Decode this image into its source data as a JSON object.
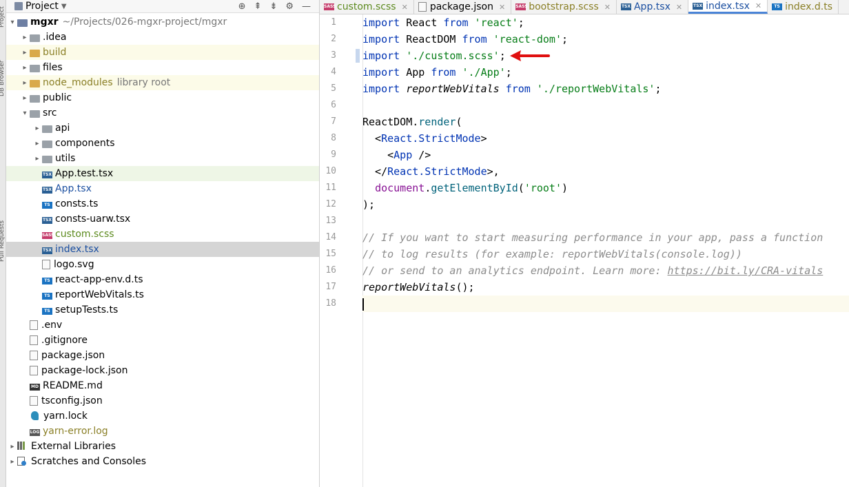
{
  "sidebar_strip": {
    "labels": [
      "Project",
      "DB Browser",
      "Pull Requests"
    ]
  },
  "panel": {
    "title": "Project",
    "tools": [
      "⊕",
      "⇞",
      "⇟",
      "⚙",
      "—"
    ]
  },
  "tree": [
    {
      "level": 0,
      "arrow": "▾",
      "icon": "module",
      "name": "mgxr",
      "extra": "~/Projects/026-mgxr-project/mgxr",
      "style": "bold"
    },
    {
      "level": 1,
      "arrow": "▸",
      "icon": "folder",
      "name": ".idea"
    },
    {
      "level": 1,
      "arrow": "▸",
      "icon": "folder-orange",
      "name": "build",
      "style": "olive",
      "bg": "hl"
    },
    {
      "level": 1,
      "arrow": "▸",
      "icon": "folder",
      "name": "files"
    },
    {
      "level": 1,
      "arrow": "▸",
      "icon": "folder-orange",
      "name": "node_modules",
      "extra": "library root",
      "style": "olive",
      "bg": "hl"
    },
    {
      "level": 1,
      "arrow": "▸",
      "icon": "folder",
      "name": "public"
    },
    {
      "level": 1,
      "arrow": "▾",
      "icon": "folder",
      "name": "src"
    },
    {
      "level": 2,
      "arrow": "▸",
      "icon": "folder",
      "name": "api"
    },
    {
      "level": 2,
      "arrow": "▸",
      "icon": "folder",
      "name": "components"
    },
    {
      "level": 2,
      "arrow": "▸",
      "icon": "folder",
      "name": "utils"
    },
    {
      "level": 2,
      "arrow": "",
      "icon": "TSX",
      "name": "App.test.tsx",
      "bg": "hl2"
    },
    {
      "level": 2,
      "arrow": "",
      "icon": "TSX",
      "name": "App.tsx",
      "style": "blue"
    },
    {
      "level": 2,
      "arrow": "",
      "icon": "TS",
      "name": "consts.ts"
    },
    {
      "level": 2,
      "arrow": "",
      "icon": "TSX",
      "name": "consts-uarw.tsx"
    },
    {
      "level": 2,
      "arrow": "",
      "icon": "SASS",
      "name": "custom.scss",
      "style": "green"
    },
    {
      "level": 2,
      "arrow": "",
      "icon": "TSX",
      "name": "index.tsx",
      "style": "blue",
      "bg": "sel"
    },
    {
      "level": 2,
      "arrow": "",
      "icon": "file",
      "name": "logo.svg"
    },
    {
      "level": 2,
      "arrow": "",
      "icon": "TS",
      "name": "react-app-env.d.ts"
    },
    {
      "level": 2,
      "arrow": "",
      "icon": "TS",
      "name": "reportWebVitals.ts"
    },
    {
      "level": 2,
      "arrow": "",
      "icon": "TS",
      "name": "setupTests.ts"
    },
    {
      "level": 1,
      "arrow": "",
      "icon": "file",
      "name": ".env"
    },
    {
      "level": 1,
      "arrow": "",
      "icon": "file",
      "name": ".gitignore"
    },
    {
      "level": 1,
      "arrow": "",
      "icon": "file",
      "name": "package.json"
    },
    {
      "level": 1,
      "arrow": "",
      "icon": "file",
      "name": "package-lock.json"
    },
    {
      "level": 1,
      "arrow": "",
      "icon": "MD",
      "name": "README.md"
    },
    {
      "level": 1,
      "arrow": "",
      "icon": "file",
      "name": "tsconfig.json"
    },
    {
      "level": 1,
      "arrow": "",
      "icon": "yarn",
      "name": "yarn.lock"
    },
    {
      "level": 1,
      "arrow": "",
      "icon": "LOG",
      "name": "yarn-error.log",
      "style": "olive"
    },
    {
      "level": 0,
      "arrow": "▸",
      "icon": "lib",
      "name": "External Libraries"
    },
    {
      "level": 0,
      "arrow": "▸",
      "icon": "scratch",
      "name": "Scratches and Consoles"
    }
  ],
  "tabs": [
    {
      "icon": "SASS",
      "label": "custom.scss",
      "style": "green",
      "close": "✕"
    },
    {
      "icon": "file",
      "label": "package.json",
      "close": "✕"
    },
    {
      "icon": "SASS",
      "label": "bootstrap.scss",
      "style": "olive",
      "close": "✕"
    },
    {
      "icon": "TSX",
      "label": "App.tsx",
      "style": "blue",
      "close": "✕"
    },
    {
      "icon": "TSX",
      "label": "index.tsx",
      "style": "blue",
      "active": true,
      "close": "✕"
    },
    {
      "icon": "TS",
      "label": "index.d.ts",
      "style": "olive",
      "close": ""
    }
  ],
  "line_numbers": [
    "1",
    "2",
    "3",
    "4",
    "5",
    "6",
    "7",
    "8",
    "9",
    "10",
    "11",
    "12",
    "13",
    "14",
    "15",
    "16",
    "17",
    "18"
  ],
  "code": {
    "l1": {
      "kw": "import",
      "a": " React ",
      "kw2": "from",
      "s": " 'react'",
      "e": ";"
    },
    "l2": {
      "kw": "import",
      "a": " ReactDOM ",
      "kw2": "from",
      "s": " 'react-dom'",
      "e": ";"
    },
    "l3": {
      "kw": "import",
      "s": " './custom.scss'",
      "e": ";"
    },
    "l4": {
      "kw": "import",
      "a": " App ",
      "kw2": "from",
      "s": " './App'",
      "e": ";"
    },
    "l5": {
      "kw": "import",
      "a": " ",
      "it": "reportWebVitals",
      "b": " ",
      "kw2": "from",
      "s": " './reportWebVitals'",
      "e": ";"
    },
    "l7": {
      "a": "ReactDOM.",
      "fn": "render",
      "e": "("
    },
    "l8": {
      "a": "  <",
      "tag": "React.StrictMode",
      "e": ">"
    },
    "l9": {
      "a": "    <",
      "tag": "App",
      "e": " />"
    },
    "l10": {
      "a": "  </",
      "tag": "React.StrictMode",
      "e": ">,"
    },
    "l11": {
      "a": "  ",
      "pur": "document",
      "b": ".",
      "fn": "getElementById",
      "c": "(",
      "s": "'root'",
      "e": ")"
    },
    "l12": {
      "a": ");"
    },
    "l14": {
      "cm": "// If you want to start measuring performance in your app, pass a function"
    },
    "l15": {
      "cm": "// to log results (for example: reportWebVitals(console.log))"
    },
    "l16": {
      "cm": "// or send to an analytics endpoint. Learn more: ",
      "link": "https://bit.ly/CRA-vitals"
    },
    "l17": {
      "it": "reportWebVitals",
      "e": "();"
    }
  },
  "colors": {
    "annotation_arrow": "#e01010",
    "active_tab_underline": "#4a84d7"
  }
}
